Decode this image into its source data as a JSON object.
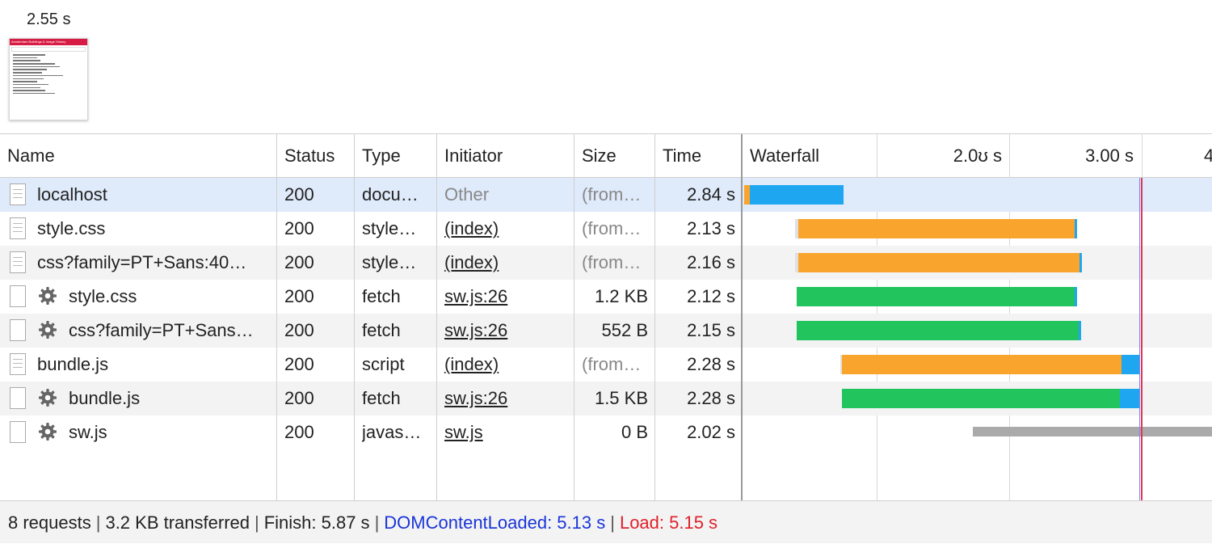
{
  "filmstrip": {
    "time": "2.55 s",
    "thumbnail_title": "Amsterdam Buildings & Image History"
  },
  "columns": {
    "name": "Name",
    "status": "Status",
    "type": "Type",
    "initiator": "Initiator",
    "size": "Size",
    "time": "Time",
    "waterfall": "Waterfall"
  },
  "waterfall_ticks": [
    "2.0ʊ s",
    "3.00 s"
  ],
  "requests": [
    {
      "name": "localhost",
      "status": "200",
      "type": "docu…",
      "initiator": "Other",
      "size": "(from…",
      "time": "2.84 s"
    },
    {
      "name": "style.css",
      "status": "200",
      "type": "style…",
      "initiator": "(index)",
      "size": "(from…",
      "time": "2.13 s"
    },
    {
      "name": "css?family=PT+Sans:40…",
      "status": "200",
      "type": "style…",
      "initiator": "(index)",
      "size": "(from…",
      "time": "2.16 s"
    },
    {
      "name": "style.css",
      "status": "200",
      "type": "fetch",
      "initiator": "sw.js:26",
      "size": "1.2 KB",
      "time": "2.12 s"
    },
    {
      "name": "css?family=PT+Sans…",
      "status": "200",
      "type": "fetch",
      "initiator": "sw.js:26",
      "size": "552 B",
      "time": "2.15 s"
    },
    {
      "name": "bundle.js",
      "status": "200",
      "type": "script",
      "initiator": "(index)",
      "size": "(from…",
      "time": "2.28 s"
    },
    {
      "name": "bundle.js",
      "status": "200",
      "type": "fetch",
      "initiator": "sw.js:26",
      "size": "1.5 KB",
      "time": "2.28 s"
    },
    {
      "name": "sw.js",
      "status": "200",
      "type": "javas…",
      "initiator": "sw.js",
      "size": "0 B",
      "time": "2.02 s"
    }
  ],
  "footer": {
    "requests": "8 requests",
    "transferred": "3.2 KB transferred",
    "finish": "Finish: 5.87 s",
    "dom_content_loaded": "DOMContentLoaded: 5.13 s",
    "load": "Load: 5.15 s"
  },
  "colors": {
    "waiting": "#f9a52d",
    "download": "#1ea7f0",
    "fetch": "#22c45e",
    "stalled": "#aaaaaa",
    "load_marker": "#e0365e",
    "selected_row": "#dfeafa"
  }
}
